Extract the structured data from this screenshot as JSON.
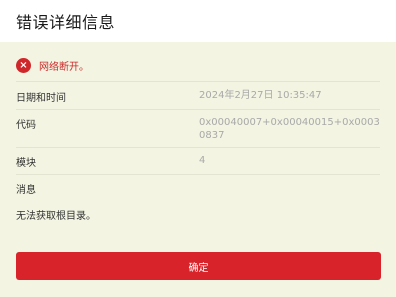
{
  "dialog": {
    "title": "错误详细信息"
  },
  "error": {
    "icon": "error-circle-x-icon",
    "icon_glyph": "×",
    "message": "网络断开。",
    "color": "#d0272b"
  },
  "details": {
    "datetime_label": "日期和时间",
    "datetime_value": "2024年2月27日 10:35:47",
    "code_label": "代码",
    "code_value": "0x00040007+0x00040015+0x00030837",
    "module_label": "模块",
    "module_value": "4",
    "message_label": "消息",
    "message_value": "无法获取根目录。"
  },
  "actions": {
    "ok_label": "确定",
    "ok_color": "#d8232a"
  }
}
